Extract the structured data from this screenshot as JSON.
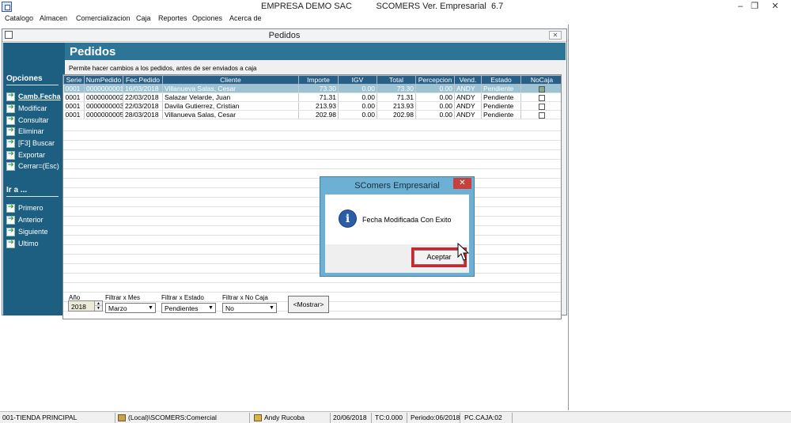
{
  "app": {
    "title": "EMPRESA DEMO SAC          SCOMERS Ver. Empresarial  6.7",
    "controls": {
      "minimize": "–",
      "restore": "❐",
      "close": "✕"
    }
  },
  "menu": [
    "Catalogo",
    "Almacen",
    "Comercializacion",
    "Caja",
    "Reportes",
    "Opciones",
    "Acerca de"
  ],
  "window": {
    "title": "Pedidos",
    "close": "✕"
  },
  "sidebar": {
    "options_header": "Opciones",
    "options": [
      "Camb.Fecha",
      "Modificar",
      "Consultar",
      "Eliminar",
      "[F3] Buscar",
      "Exportar",
      "Cerrar=(Esc)"
    ],
    "goto_header": "Ir a ...",
    "goto": [
      "Primero",
      "Anterior",
      "Siguiente",
      "Ultimo"
    ]
  },
  "main": {
    "header": "Pedidos",
    "description": "Permite hacer cambios a los pedidos, antes de ser enviados a caja"
  },
  "grid": {
    "columns": [
      "Serie",
      "NumPedido",
      "Fec.Pedido",
      "Cliente",
      "Importe",
      "IGV",
      "Total",
      "Percepcion",
      "Vend.",
      "Estado",
      "NoCaja"
    ],
    "rows": [
      [
        "0001",
        "0000000001",
        "16/03/2018",
        "Villanueva  Salas, Cesar",
        "73.30",
        "0.00",
        "73.30",
        "0.00",
        "ANDY",
        "Pendiente"
      ],
      [
        "0001",
        "0000000002",
        "22/03/2018",
        "Salazar Velarde, Juan",
        "71.31",
        "0.00",
        "71.31",
        "0.00",
        "ANDY",
        "Pendiente"
      ],
      [
        "0001",
        "0000000003",
        "22/03/2018",
        "Davila Gutierrez, Cristian",
        "213.93",
        "0.00",
        "213.93",
        "0.00",
        "ANDY",
        "Pendiente"
      ],
      [
        "0001",
        "0000000005",
        "28/03/2018",
        "Villanueva  Salas, Cesar",
        "202.98",
        "0.00",
        "202.98",
        "0.00",
        "ANDY",
        "Pendiente"
      ]
    ]
  },
  "filters": {
    "year_label": "Año",
    "year_value": "2018",
    "month_label": "Filtrar x Mes",
    "month_value": "Marzo",
    "state_label": "Filtrar x Estado",
    "state_value": "Pendientes",
    "nocaja_label": "Filtrar x No Caja",
    "nocaja_value": "No",
    "show_button": "<Mostrar>"
  },
  "dialog": {
    "title": "SComers Empresarial",
    "message": "Fecha Modificada Con Exito",
    "ok": "Aceptar",
    "close": "✕",
    "icon": "info-icon"
  },
  "statusbar": [
    "001-TIENDA PRINCIPAL",
    "(Local)\\SCOMERS:Comercial",
    "Andy Rucoba",
    "20/06/2018",
    "TC:0.000",
    "Periodo:06/2018",
    "PC.CAJA:02"
  ],
  "colors": {
    "sidebar": "#1d5f81",
    "header": "#2c7596",
    "grid_header": "#285f87",
    "selected_row": "#9cc3d4",
    "dialog_frame": "#6cb0d4",
    "highlight": "#d8202a"
  }
}
